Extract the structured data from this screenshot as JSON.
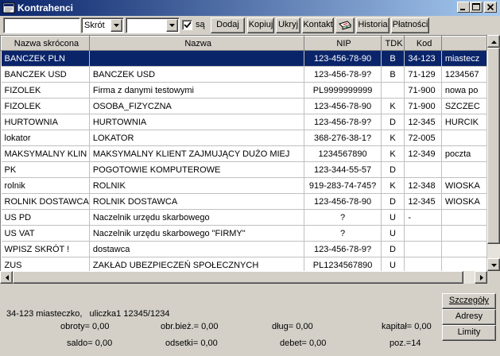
{
  "window": {
    "title": "Kontrahenci"
  },
  "toolbar": {
    "search_value": "",
    "field_select": "Skrót",
    "mode_select": "",
    "checkbox_checked": true,
    "checkbox_label": "są",
    "buttons": {
      "dodaj": "Dodaj",
      "kopiuj": "Kopiuj",
      "ukryj": "Ukryj",
      "kontakt": "Kontakt",
      "historia": "Historia",
      "platnosci": "Płatności"
    }
  },
  "table": {
    "columns": [
      "Nazwa skrócona",
      "Nazwa",
      "NIP",
      "TDK",
      "Kod",
      ""
    ],
    "rows": [
      [
        "BANCZEK PLN",
        "",
        "123-456-78-90",
        "B",
        "34-123",
        "miastecz"
      ],
      [
        "BANCZEK USD",
        "BANCZEK USD",
        "123-456-78-9?",
        "B",
        "71-129",
        "1234567"
      ],
      [
        "FIZOLEK",
        "Firma z danymi testowymi",
        "PL9999999999",
        "",
        "71-900",
        "nowa po"
      ],
      [
        "FIZOLEK",
        "OSOBA_FIZYCZNA",
        "123-456-78-90",
        "K",
        "71-900",
        "SZCZEC"
      ],
      [
        "HURTOWNIA",
        "HURTOWNIA",
        "123-456-78-9?",
        "D",
        "12-345",
        "HURCIK"
      ],
      [
        "lokator",
        "LOKATOR",
        "368-276-38-1?",
        "K",
        "72-005",
        ""
      ],
      [
        "MAKSYMALNY KLIN",
        "MAKSYMALNY KLIENT ZAJMUJĄCY DUŻO MIEJ",
        "1234567890",
        "K",
        "12-349",
        "poczta"
      ],
      [
        "PK",
        "POGOTOWIE KOMPUTEROWE",
        "123-344-55-57",
        "D",
        "",
        ""
      ],
      [
        "rolnik",
        "ROLNIK",
        "919-283-74-745?",
        "K",
        "12-348",
        "WIOSKA"
      ],
      [
        "ROLNIK DOSTAWCA",
        "ROLNIK DOSTAWCA",
        "123-456-78-90",
        "D",
        "12-345",
        "WIOSKA"
      ],
      [
        "US PD",
        "Naczelnik urzędu skarbowego",
        "?",
        "U",
        "-",
        ""
      ],
      [
        "US VAT",
        "Naczelnik urzędu skarbowego \"FIRMY\"",
        "?",
        "U",
        "",
        ""
      ],
      [
        "WPISZ SKRÓT !",
        "dostawca",
        "123-456-78-9?",
        "D",
        "",
        ""
      ],
      [
        "ZUS",
        "ZAKŁAD UBEZPIECZEŃ SPOŁECZNYCH",
        "PL1234567890",
        "U",
        "",
        ""
      ]
    ],
    "selected_row": 0
  },
  "details": {
    "address": "34-123 miasteczko,   uliczka1 12345/1234",
    "obroty": "obroty= 0,00",
    "obr_biez": "obr.bież.= 0,00",
    "dlug": "dług= 0,00",
    "kapital": "kapitał= 0,00",
    "saldo": "saldo= 0,00",
    "odsetki": "odsetki= 0,00",
    "debet": "debet= 0,00",
    "poz": "poz.=14"
  },
  "side_buttons": {
    "szczegoly": "Szczegóły",
    "adresy": "Adresy",
    "limity": "Limity"
  },
  "colors": {
    "title_start": "#0a246a",
    "title_end": "#a6caf0",
    "selection": "#0a246a",
    "face": "#d4d0c8"
  }
}
